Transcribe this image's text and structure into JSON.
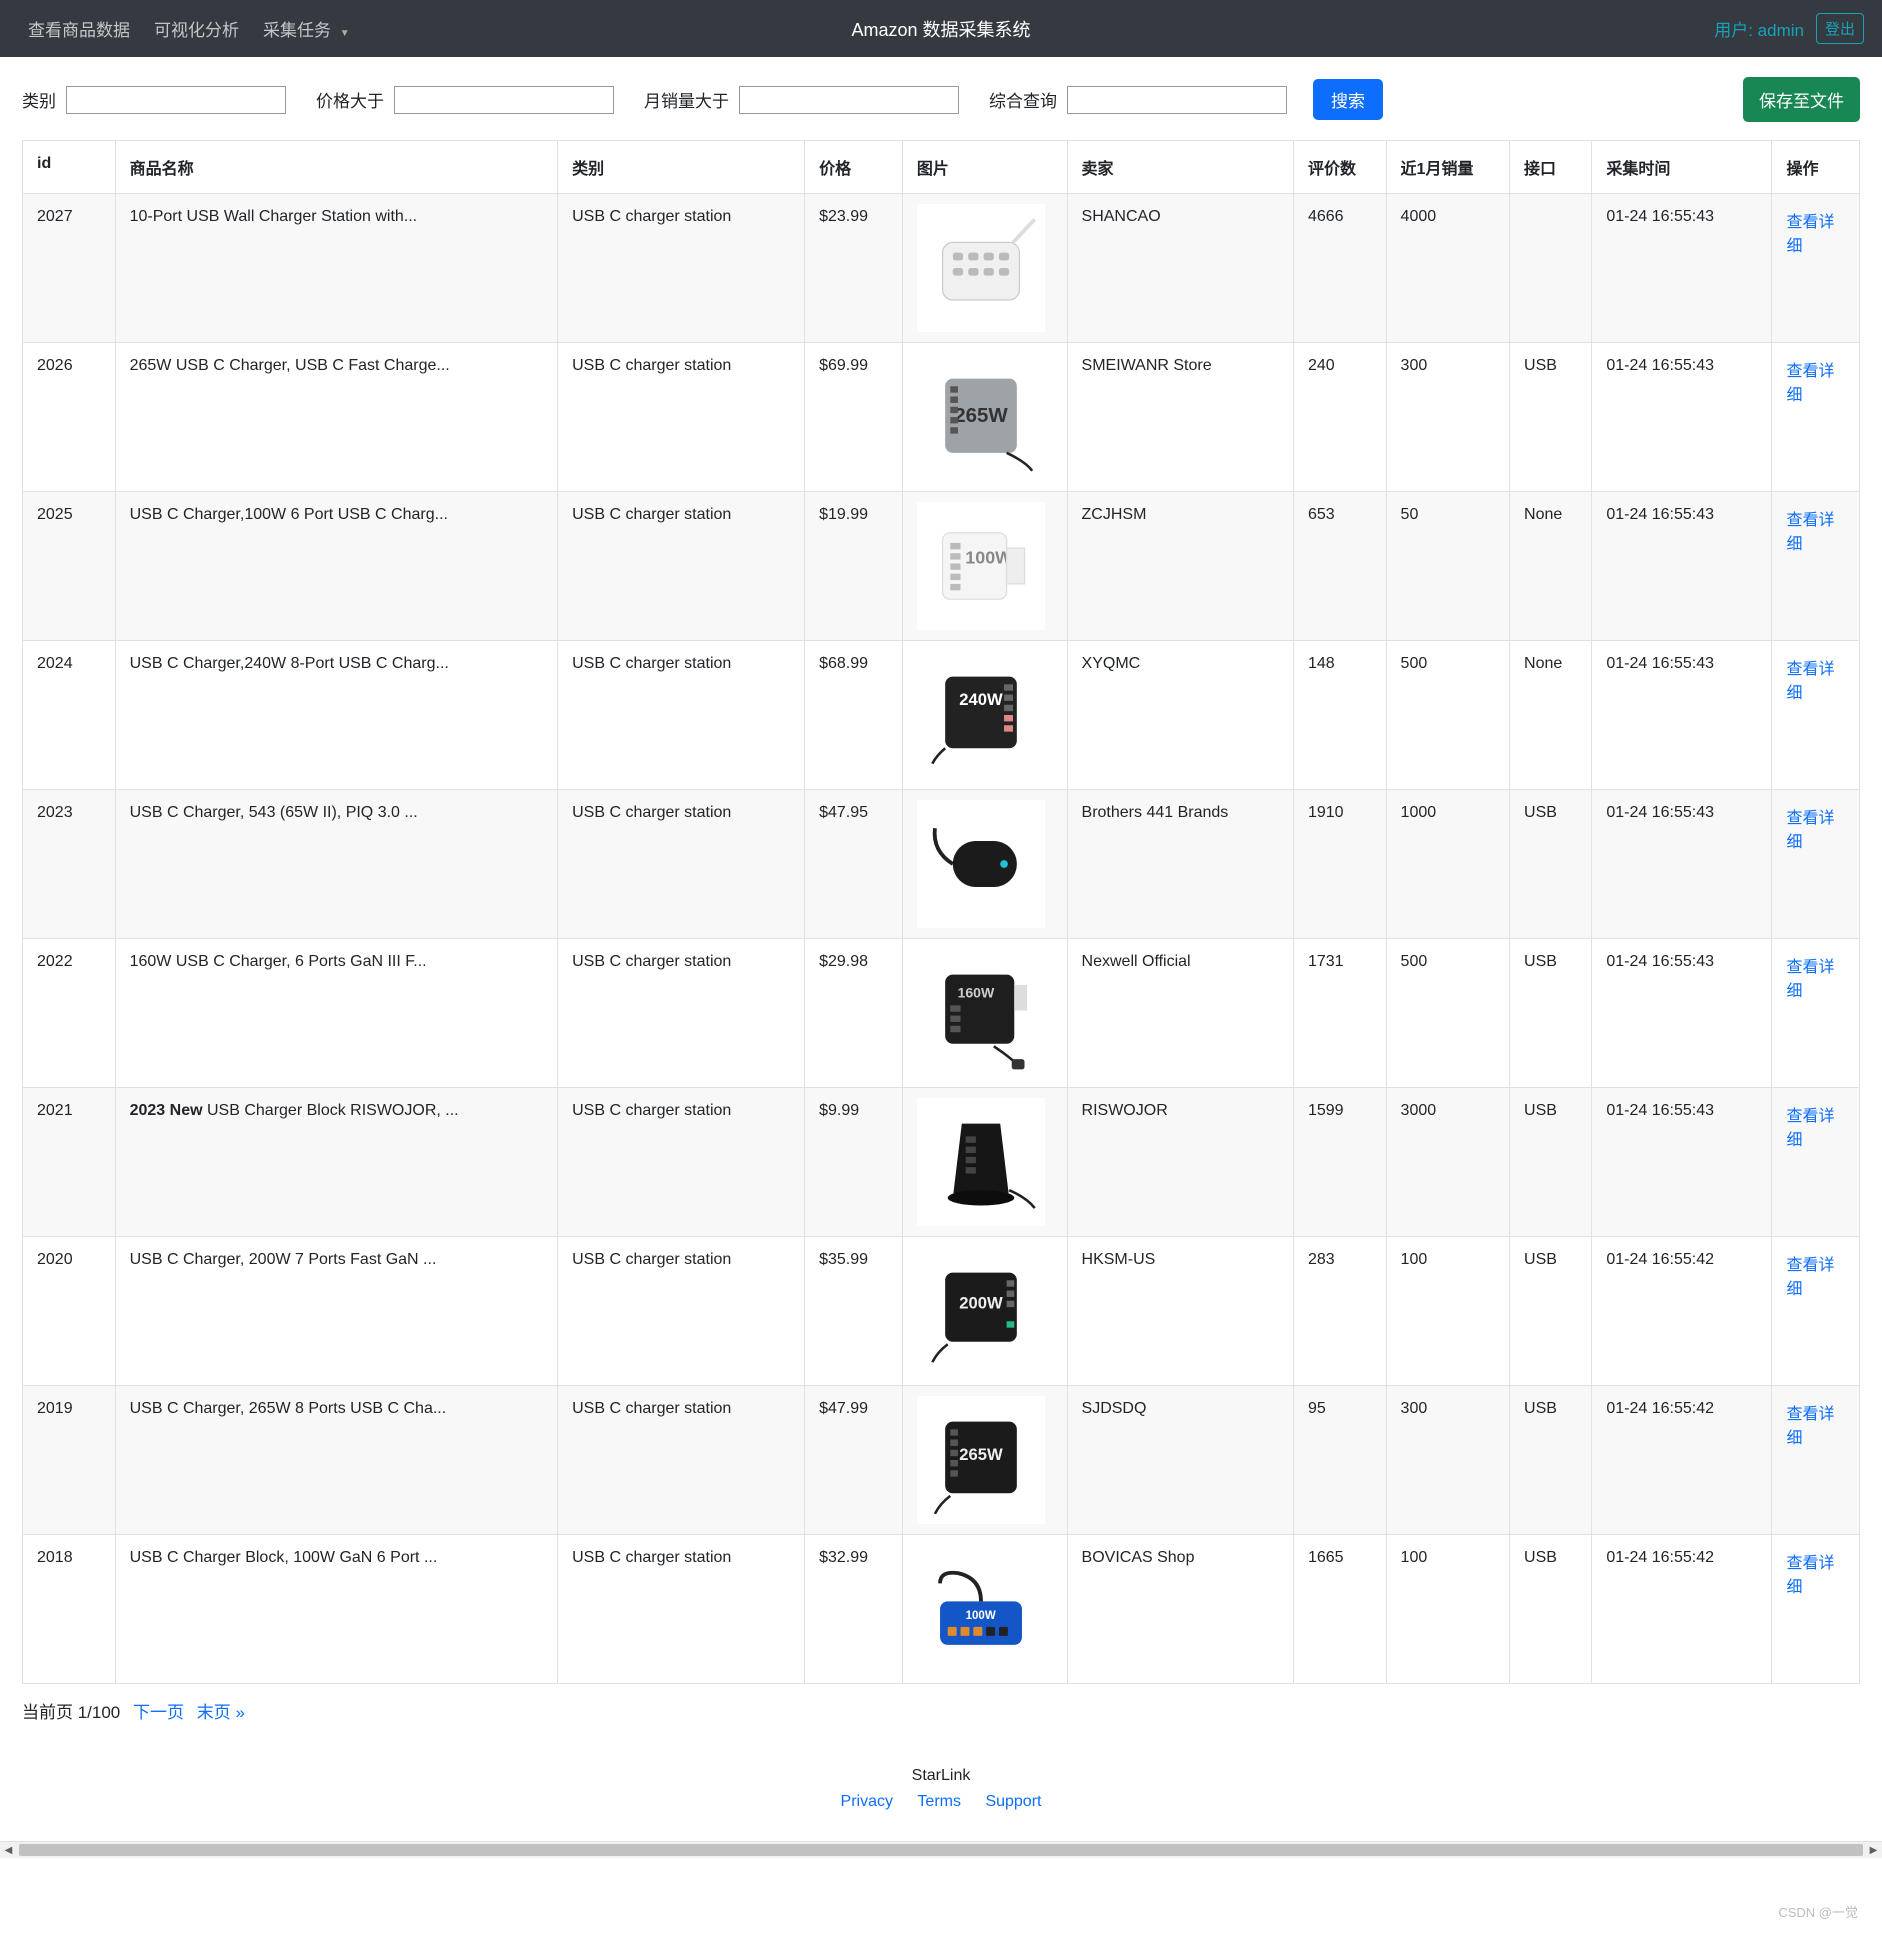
{
  "nav": {
    "items": [
      "查看商品数据",
      "可视化分析",
      "采集任务"
    ],
    "brand": "Amazon 数据采集系统",
    "user_prefix": "用户:",
    "user_name": "admin",
    "logout": "登出"
  },
  "filters": {
    "category_label": "类别",
    "price_gt_label": "价格大于",
    "monthly_sales_gt_label": "月销量大于",
    "query_label": "综合查询",
    "search_btn": "搜索",
    "save_btn": "保存至文件"
  },
  "table": {
    "headers": {
      "id": "id",
      "name": "商品名称",
      "category": "类别",
      "price": "价格",
      "image": "图片",
      "seller": "卖家",
      "reviews": "评价数",
      "sales": "近1月销量",
      "port": "接口",
      "time": "采集时间",
      "action": "操作"
    },
    "action_label": "查看详细",
    "rows": [
      {
        "id": "2027",
        "name": "10-Port USB Wall Charger Station with...",
        "category": "USB C charger station",
        "price": "$23.99",
        "seller": "SHANCAO",
        "reviews": "4666",
        "sales": "4000",
        "port": "",
        "time": "01-24 16:55:43",
        "thumb": "strip-white"
      },
      {
        "id": "2026",
        "name": "265W USB C Charger, USB C Fast Charge...",
        "category": "USB C charger station",
        "price": "$69.99",
        "seller": "SMEIWANR Store",
        "reviews": "240",
        "sales": "300",
        "port": "USB",
        "time": "01-24 16:55:43",
        "thumb": "box-265w"
      },
      {
        "id": "2025",
        "name": "USB C Charger,100W 6 Port USB C Charg...",
        "category": "USB C charger station",
        "price": "$19.99",
        "seller": "ZCJHSM",
        "reviews": "653",
        "sales": "50",
        "port": "None",
        "time": "01-24 16:55:43",
        "thumb": "wall-100w"
      },
      {
        "id": "2024",
        "name": "USB C Charger,240W 8-Port USB C Charg...",
        "category": "USB C charger station",
        "price": "$68.99",
        "seller": "XYQMC",
        "reviews": "148",
        "sales": "500",
        "port": "None",
        "time": "01-24 16:55:43",
        "thumb": "black-240w"
      },
      {
        "id": "2023",
        "name": "USB C Charger, 543 (65W II), PIQ 3.0 ...",
        "category": "USB C charger station",
        "price": "$47.95",
        "seller": "Brothers 441 Brands",
        "reviews": "1910",
        "sales": "1000",
        "port": "USB",
        "time": "01-24 16:55:43",
        "thumb": "black-round"
      },
      {
        "id": "2022",
        "name": "160W USB C Charger, 6 Ports GaN III F...",
        "category": "USB C charger station",
        "price": "$29.98",
        "seller": "Nexwell Official",
        "reviews": "1731",
        "sales": "500",
        "port": "USB",
        "time": "01-24 16:55:43",
        "thumb": "black-160w"
      },
      {
        "id": "2021",
        "name_prefix_bold": "2023 New",
        "name_rest": " USB Charger Block RISWOJOR, ...",
        "name": "2023 New USB Charger Block RISWOJOR, ...",
        "category": "USB C charger station",
        "price": "$9.99",
        "seller": "RISWOJOR",
        "reviews": "1599",
        "sales": "3000",
        "port": "USB",
        "time": "01-24 16:55:43",
        "thumb": "tower-black"
      },
      {
        "id": "2020",
        "name": "USB C Charger, 200W 7 Ports Fast GaN ...",
        "category": "USB C charger station",
        "price": "$35.99",
        "seller": "HKSM-US",
        "reviews": "283",
        "sales": "100",
        "port": "USB",
        "time": "01-24 16:55:42",
        "thumb": "black-200w"
      },
      {
        "id": "2019",
        "name": "USB C Charger, 265W 8 Ports USB C Cha...",
        "category": "USB C charger station",
        "price": "$47.99",
        "seller": "SJDSDQ",
        "reviews": "95",
        "sales": "300",
        "port": "USB",
        "time": "01-24 16:55:42",
        "thumb": "black-265w"
      },
      {
        "id": "2018",
        "name": "USB C Charger Block, 100W GaN 6 Port ...",
        "category": "USB C charger station",
        "price": "$32.99",
        "seller": "BOVICAS Shop",
        "reviews": "1665",
        "sales": "100",
        "port": "USB",
        "time": "01-24 16:55:42",
        "thumb": "blue-100w"
      }
    ]
  },
  "pagination": {
    "current_text": "当前页 1/100",
    "next_label": "下一页",
    "last_label": "末页 »"
  },
  "footer": {
    "brand": "StarLink",
    "links": [
      "Privacy",
      "Terms",
      "Support"
    ]
  },
  "watermark": "CSDN @一觉"
}
